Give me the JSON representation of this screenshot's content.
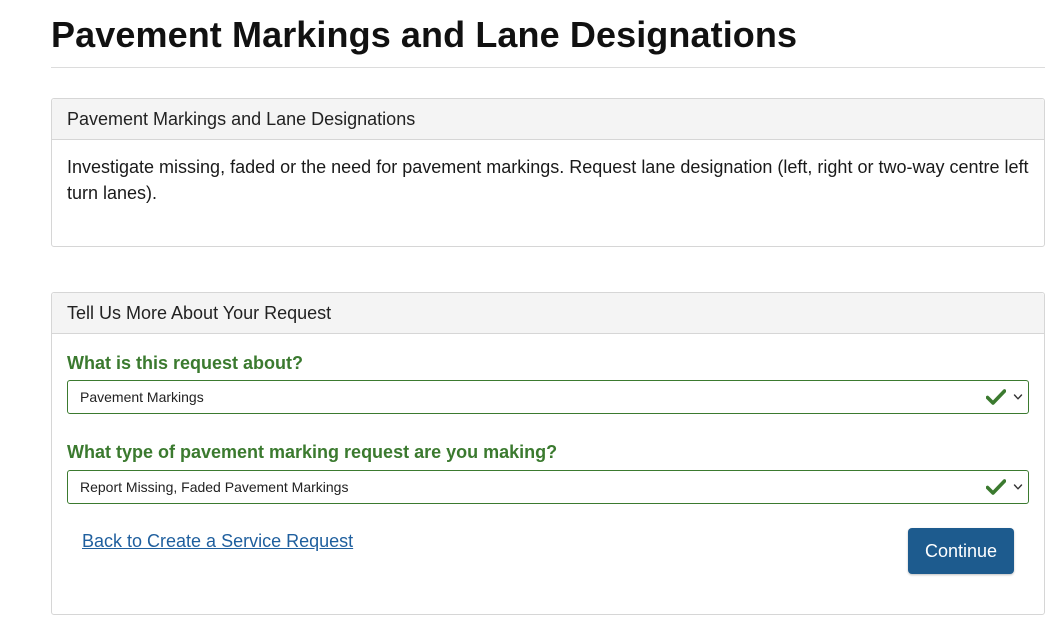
{
  "page": {
    "title": "Pavement Markings and Lane Designations"
  },
  "info_panel": {
    "heading": "Pavement Markings and Lane Designations",
    "description": "Investigate missing, faded or the need for pavement markings. Request lane designation (left, right or two-way centre left turn lanes)."
  },
  "form_panel": {
    "heading": "Tell Us More About Your Request",
    "question1": {
      "label": "What is this request about?",
      "selected": "Pavement Markings",
      "status_icon": "check-icon",
      "dropdown_icon": "chevron-down-icon"
    },
    "question2": {
      "label": "What type of pavement marking request are you making?",
      "selected": "Report Missing, Faded Pavement Markings",
      "status_icon": "check-icon",
      "dropdown_icon": "chevron-down-icon"
    },
    "back_link": "Back to Create a Service Request",
    "continue_label": "Continue"
  },
  "colors": {
    "accent_green": "#3b7a2f",
    "link_blue": "#1f5f9e",
    "button_blue": "#1d5b8e",
    "panel_heading_bg": "#f4f4f4"
  }
}
